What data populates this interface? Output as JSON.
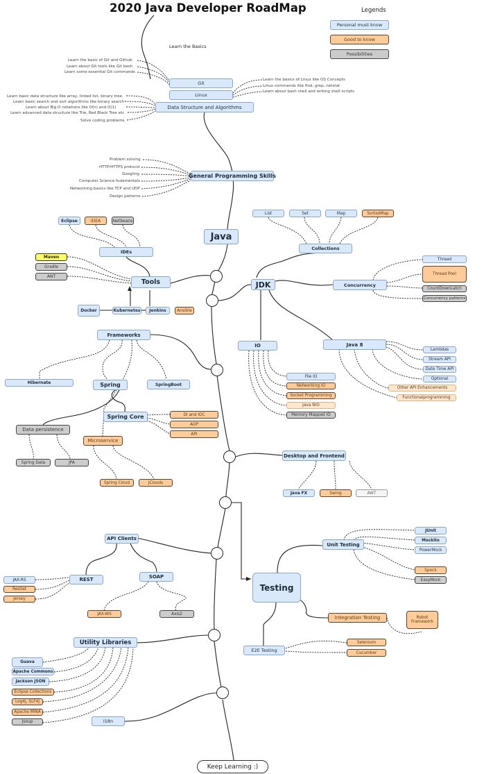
{
  "title": "2020 Java Developer RoadMap",
  "legend": {
    "heading": "Legends",
    "items": [
      {
        "label": "Personal must know",
        "color": "#dae8fc"
      },
      {
        "label": "Good to know",
        "color": "#ffcc99"
      },
      {
        "label": "Possibilities",
        "color": "#cccccc"
      }
    ]
  },
  "basics": {
    "label": "Learn the Basics",
    "git": {
      "label": "Git",
      "notes": [
        "Learn the basic of Git and Github",
        "Learn about Git tools like Git bash",
        "Learn some essential Git commands"
      ]
    },
    "linux": {
      "label": "Linux",
      "notes": [
        "Learn the basics of Linux like OS Concepts",
        "Linux commands like find, grep, netstat",
        "Learn about bash shell and writing shell scripts"
      ]
    },
    "dsa": {
      "label": "Data Structure and Algorithms",
      "notes": [
        "Learn basic data structure like array, linked list, binary tree.",
        "Learn basic search and sort algorithms like binary search",
        "Learn about Big O notations like O(n) and O(1)",
        "Learn advanced data structure like Trie, Red Black Tree etc",
        "Solve coding problems"
      ]
    }
  },
  "gps": {
    "label": "General Programming Skills",
    "notes": [
      "Problem solving",
      "HTTP/HTTPS protocol",
      "Googling",
      "Computer Science fudamentals",
      "Networking basics like TCP and UDP",
      "Design patterns"
    ]
  },
  "java": {
    "label": "Java"
  },
  "ides": {
    "label": "IDEs",
    "items": [
      "Eclipse",
      "IDEA",
      "Netbeans"
    ]
  },
  "tools": {
    "label": "Tools",
    "build": [
      "Maven",
      "Gradle",
      "ANT"
    ],
    "devops": [
      "Docker",
      "Kubernetes",
      "Jenkins",
      "Ansible"
    ]
  },
  "jdk": {
    "label": "JDK"
  },
  "collections": {
    "label": "Collections",
    "items": [
      "List",
      "Set",
      "Map",
      "SortedMap"
    ]
  },
  "concurrency": {
    "label": "Concurrency",
    "items": [
      "Thread",
      "Thread Pool",
      "CountDownLatch",
      "Concurrency patterns"
    ]
  },
  "io": {
    "label": "IO",
    "items": [
      "File IO",
      "Networking IO",
      "Socket Programming",
      "Java NIO",
      "Memory Mapped IO"
    ]
  },
  "java8": {
    "label": "Java 8",
    "items": [
      "Lambdas",
      "Stream API",
      "Date Time API",
      "Optional",
      "Other API Enhancements",
      "Functionalprogramming"
    ]
  },
  "frameworks": {
    "label": "Frameworks",
    "items": [
      "Hibernate",
      "Spring",
      "SpringBoot"
    ]
  },
  "spring": {
    "core": "Spring  Core",
    "core_items": [
      "DI and IOC",
      "AOP",
      "API"
    ],
    "persistence": "Data persistence",
    "persistence_items": [
      "Spring Data",
      "JPA"
    ],
    "micro": "Microservice",
    "micro_items": [
      "Spring Cloud",
      "JClouds"
    ]
  },
  "desktop": {
    "label": "Desktop and Frontend",
    "items": [
      "Java FX",
      "Swing",
      "AWT"
    ]
  },
  "api": {
    "label": "API Clients",
    "rest": "REST",
    "rest_items": [
      "JAX-RS",
      "Restlet",
      "Jersey"
    ],
    "soap": "SOAP",
    "soap_items": [
      "JAX-WS",
      "Axis2"
    ]
  },
  "testing": {
    "label": "Testing",
    "unit": "Unit Testing",
    "unit_items": [
      "JUnit",
      "Mockito",
      "PowerMock",
      "Spock",
      "EasyMock"
    ],
    "integration": "Integration Testing",
    "integration_items": [
      "Robot Framework"
    ],
    "e2e": "E2E Testing",
    "e2e_items": [
      "Selenium",
      "Cucumber"
    ]
  },
  "utility": {
    "label": "Utility Libraries",
    "items": [
      "Guava",
      "Apache Commons",
      "Jackson JSON",
      "Eclipse Collections",
      "Log4j, SLF4j",
      "Apache MINA",
      "Jsoup"
    ]
  },
  "i18n": {
    "label": "I18n"
  },
  "end": {
    "label": "Keep Learning :)"
  }
}
